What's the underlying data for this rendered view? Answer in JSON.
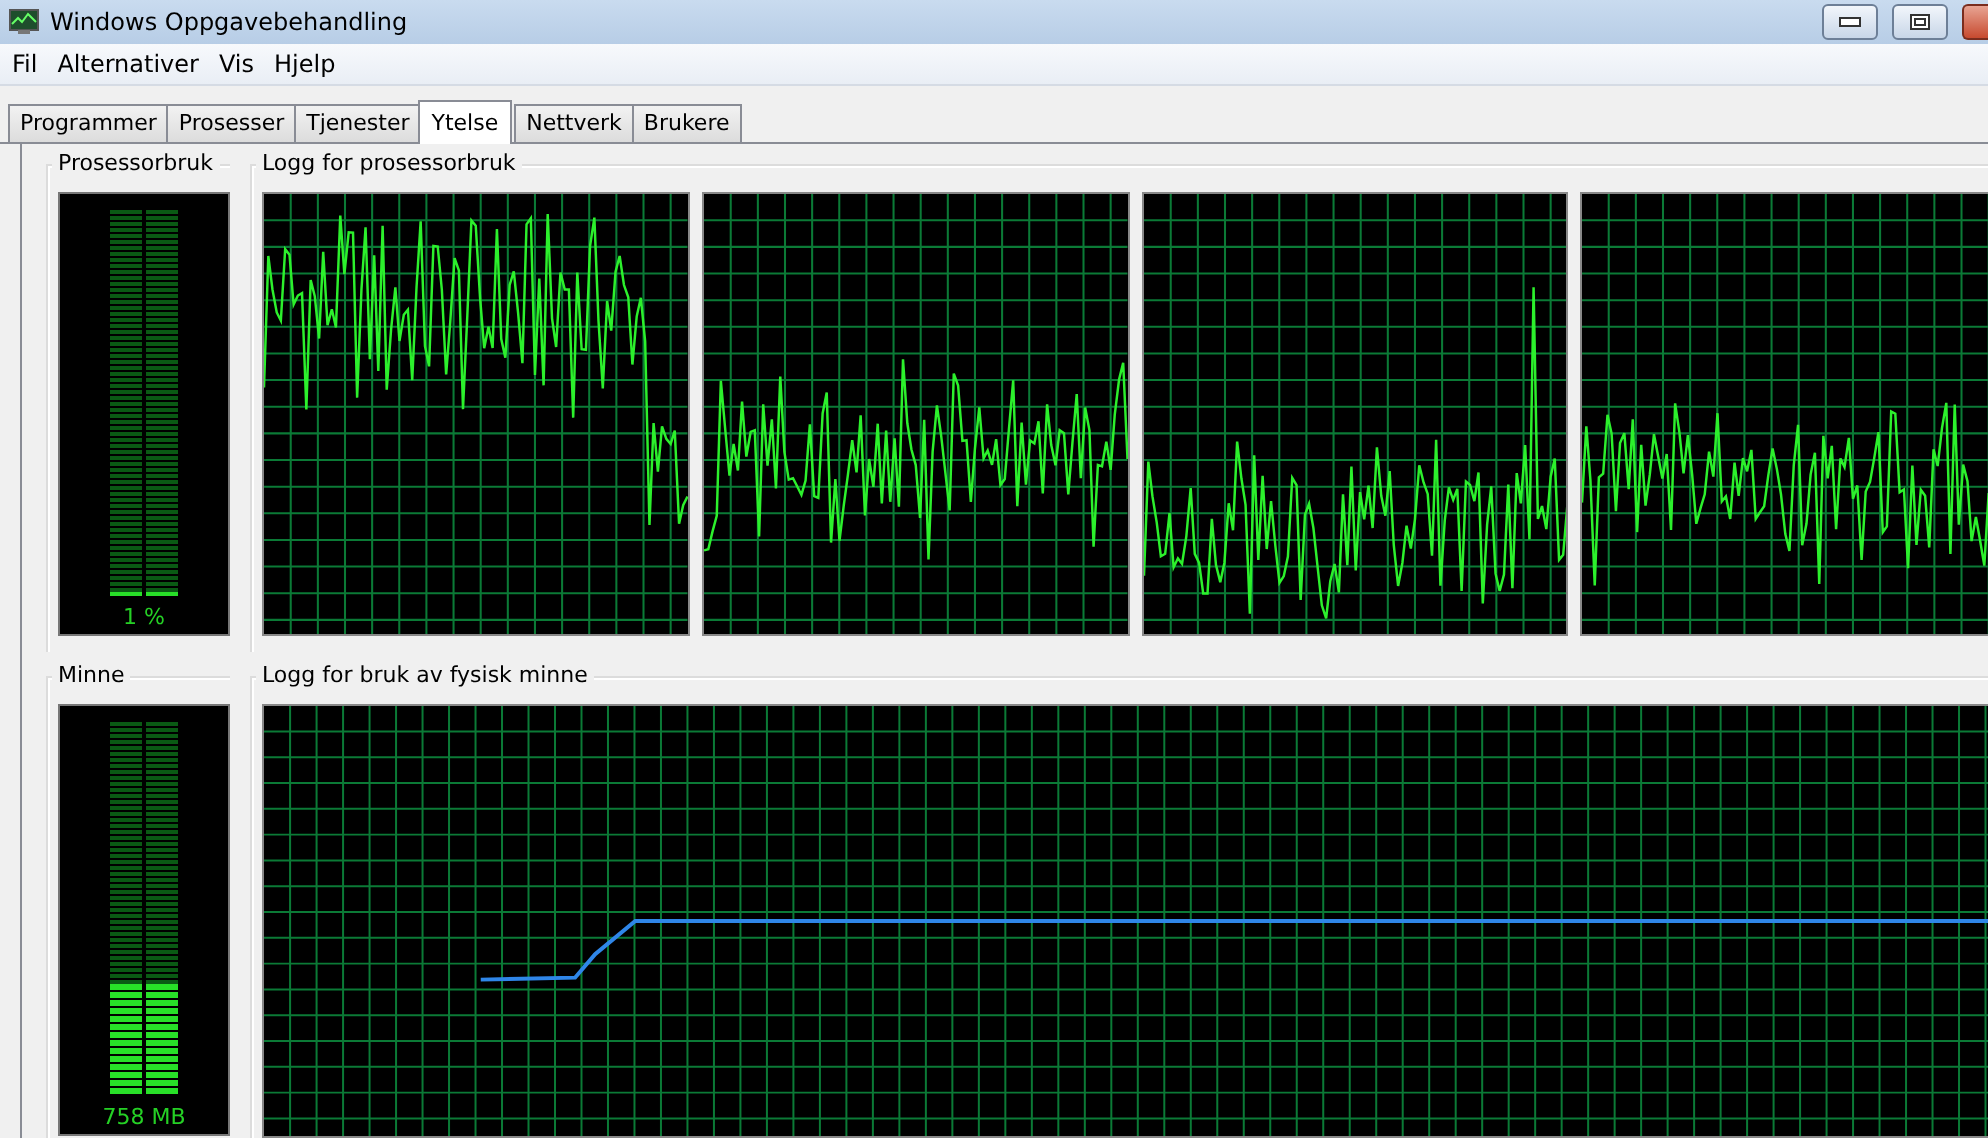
{
  "window": {
    "title": "Windows Oppgavebehandling"
  },
  "menu": [
    "Fil",
    "Alternativer",
    "Vis",
    "Hjelp"
  ],
  "tabs": [
    {
      "label": "Programmer",
      "selected": false
    },
    {
      "label": "Prosesser",
      "selected": false
    },
    {
      "label": "Tjenester",
      "selected": false
    },
    {
      "label": "Ytelse",
      "selected": true
    },
    {
      "label": "Nettverk",
      "selected": false
    },
    {
      "label": "Brukere",
      "selected": false
    }
  ],
  "cpu": {
    "title": "Prosessorbruk",
    "level": 0.01,
    "reading": "1 %"
  },
  "cpu_history": {
    "title": "Logg for prosessorbruk",
    "graphs": [
      {
        "kind": "cpu"
      },
      {
        "kind": "cpu"
      },
      {
        "kind": "cpu"
      },
      {
        "kind": "cpu"
      }
    ]
  },
  "memory": {
    "title": "Minne",
    "level": 0.3,
    "reading": "758 MB"
  },
  "memory_history": {
    "title": "Logg for bruk av fysisk minne",
    "graphs": [
      {
        "kind": "memory"
      }
    ]
  }
}
